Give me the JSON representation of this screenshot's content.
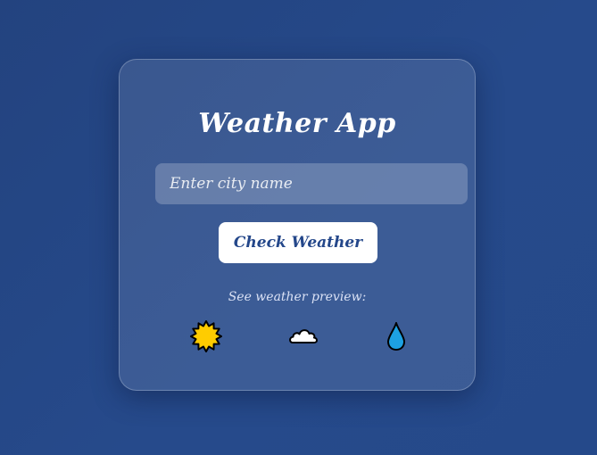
{
  "app": {
    "title": "Weather App"
  },
  "search": {
    "placeholder": "Enter city name",
    "value": ""
  },
  "actions": {
    "check_label": "Check Weather"
  },
  "preview": {
    "label": "See weather preview:",
    "icons": [
      "sun-icon",
      "cloud-icon",
      "raindrop-icon"
    ]
  },
  "colors": {
    "background": "#25498a",
    "button_text": "#24478a",
    "sun": "#ffcc00",
    "raindrop": "#1da1e2"
  }
}
